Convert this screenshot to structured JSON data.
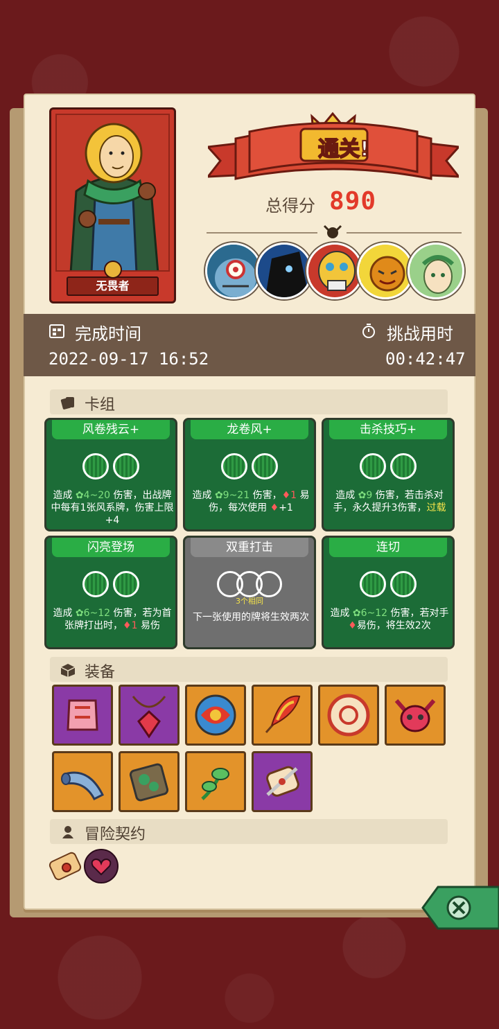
{
  "hero": {
    "name": "无畏者"
  },
  "result": {
    "banner": "通关!",
    "score_label": "总得分",
    "score_value": "890"
  },
  "bosses": [
    {
      "name": "blue-cyclops-boss"
    },
    {
      "name": "shadow-beast-boss"
    },
    {
      "name": "masked-tribal-boss"
    },
    {
      "name": "sun-pumpkin-boss"
    },
    {
      "name": "forest-elf-boss"
    }
  ],
  "info": {
    "finish_label": "完成时间",
    "finish_value": "2022-09-17 16:52",
    "duration_label": "挑战用时",
    "duration_value": "00:42:47"
  },
  "sections": {
    "deck": "卡组",
    "equipment": "装备",
    "contract": "冒险契约"
  },
  "cards": [
    {
      "title": "风卷残云+",
      "style": "green",
      "cost": 2,
      "text": "造成 ",
      "hl": "4~20",
      "text2": " 伤害，出战牌中每有1张风系牌，伤害上限+4"
    },
    {
      "title": "龙卷风+",
      "style": "green",
      "cost": 2,
      "text": "造成 ",
      "hl": "9~21",
      "text2": " 伤害，",
      "hl2": "1",
      "text3": " 易伤，每次使用 ",
      "extra": "+1"
    },
    {
      "title": "击杀技巧+",
      "style": "green",
      "cost": 2,
      "text": "造成 ",
      "hl": "9",
      "text2": " 伤害，若击杀对手，永久提升3伤害，",
      "yellow": "过载"
    },
    {
      "title": "闪亮登场",
      "style": "green",
      "cost": 2,
      "text": "造成 ",
      "hl": "6~12",
      "text2": " 伤害，若为首张牌打出时，",
      "hl2": "1",
      "text3": " 易伤"
    },
    {
      "title": "双重打击",
      "style": "gray",
      "cost": 3,
      "tag": "3个相同",
      "text": "下一张使用的牌将生效两次"
    },
    {
      "title": "连切",
      "style": "green",
      "cost": 2,
      "text": "造成 ",
      "hl": "6~12",
      "text2": " 伤害，若对手",
      "text3": "易伤，将生效2次"
    }
  ],
  "equipment": [
    {
      "name": "pink-armor-item",
      "color": "purple"
    },
    {
      "name": "red-gem-necklace-item",
      "color": "purple"
    },
    {
      "name": "swirl-disc-item",
      "color": "orange"
    },
    {
      "name": "fire-feather-item",
      "color": "orange"
    },
    {
      "name": "ring-disc-item",
      "color": "orange"
    },
    {
      "name": "horned-skull-item",
      "color": "orange"
    },
    {
      "name": "horn-item",
      "color": "orange"
    },
    {
      "name": "moss-stone-item",
      "color": "orange"
    },
    {
      "name": "green-sprout-item",
      "color": "orange"
    },
    {
      "name": "blade-scroll-item",
      "color": "purple"
    }
  ],
  "contracts": [
    {
      "name": "scroll-contract-icon"
    },
    {
      "name": "heart-contract-icon"
    }
  ],
  "colors": {
    "accent_red": "#e23a2a",
    "card_green": "#1c6c37",
    "panel_brown": "#6e5847"
  }
}
